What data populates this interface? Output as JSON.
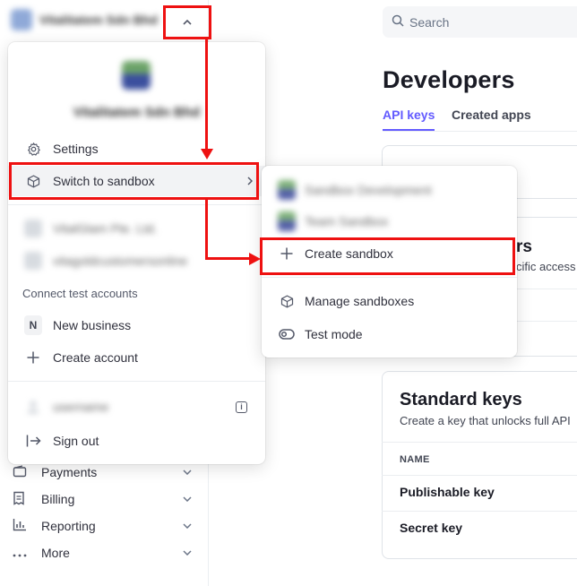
{
  "sidebar": {
    "account_name": "Vitalitatem Sdn Bhd",
    "toggle_icon": "chevron-up-icon",
    "nav": [
      {
        "label": "Payments",
        "icon": "wallet-icon"
      },
      {
        "label": "Billing",
        "icon": "billing-icon"
      },
      {
        "label": "Reporting",
        "icon": "bar-chart-icon"
      },
      {
        "label": "More",
        "icon": "more-dots-icon"
      }
    ]
  },
  "search": {
    "placeholder": "Search"
  },
  "page": {
    "title": "Developers",
    "tabs": [
      {
        "label": "API keys",
        "active": true
      },
      {
        "label": "Created apps",
        "active": false
      }
    ],
    "partial_text": {
      "rs": "rs",
      "access": "cific access"
    },
    "standard_keys": {
      "title": "Standard keys",
      "subtitle": "Create a key that unlocks full API",
      "column_name": "NAME",
      "rows": [
        "Publishable key",
        "Secret key"
      ]
    }
  },
  "account_menu": {
    "account_name": "Vitalitatem Sdn Bhd",
    "settings_label": "Settings",
    "switch_sandbox_label": "Switch to sandbox",
    "other_accounts": [
      "VitalGlam Pte. Ltd.",
      "vitagoldcustomersonline"
    ],
    "connect_test_label": "Connect test accounts",
    "new_business_badge": "N",
    "new_business_label": "New business",
    "create_account_label": "Create account",
    "user_name": "username",
    "sign_out_label": "Sign out"
  },
  "sandbox_menu": {
    "sandboxes": [
      "Sandbox Development",
      "Team Sandbox"
    ],
    "create_label": "Create sandbox",
    "manage_label": "Manage sandboxes",
    "test_mode_label": "Test mode"
  },
  "colors": {
    "accent": "#635bff",
    "annotation": "#ee1111"
  }
}
